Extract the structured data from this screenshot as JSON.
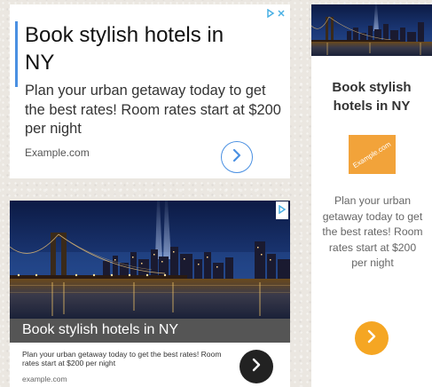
{
  "ads": {
    "text_ad": {
      "headline": "Book stylish hotels in NY",
      "description": "Plan your urban getaway today to get the best rates! Room rates start at $200 per night",
      "display_url": "Example.com",
      "cta_icon": "chevron-right-icon",
      "adchoices_icons": [
        "adchoices-icon",
        "close-icon"
      ]
    },
    "image_ad": {
      "headline": "Book stylish hotels in NY",
      "description": "Plan your urban getaway today to get the best rates! Room rates start at $200 per night",
      "display_url": "example.com",
      "image": "nyc-brooklyn-bridge-night-photo",
      "cta_icon": "chevron-right-icon",
      "adchoices_icon": "adchoices-icon"
    },
    "skyscraper_ad": {
      "headline": "Book stylish hotels in NY",
      "logo_text": "Example.com",
      "description": "Plan your urban getaway today to get the best rates! Room rates start at $200 per night",
      "image": "nyc-brooklyn-bridge-night-photo",
      "cta_icon": "chevron-right-icon"
    }
  },
  "colors": {
    "background": "#ebe7e1",
    "accent_blue": "#4a90e2",
    "logo_orange": "#f2a33a",
    "cta_orange": "#f5a623",
    "cta_dark": "#222222",
    "caption_bar": "#555555"
  }
}
